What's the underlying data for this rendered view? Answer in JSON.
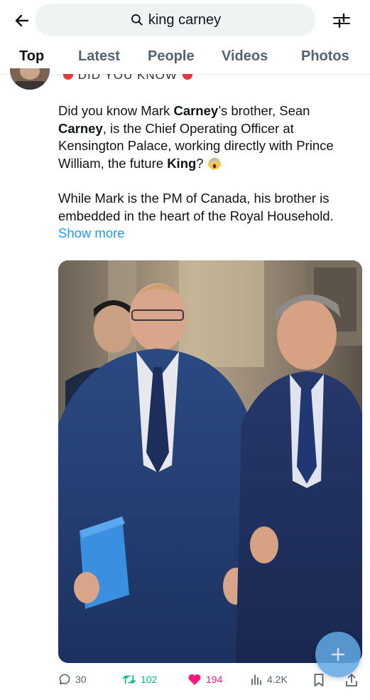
{
  "search": {
    "query": "king carney"
  },
  "tabs": [
    {
      "label": "Top",
      "active": true
    },
    {
      "label": "Latest",
      "active": false
    },
    {
      "label": "People",
      "active": false
    },
    {
      "label": "Videos",
      "active": false
    },
    {
      "label": "Photos",
      "active": false
    }
  ],
  "post": {
    "header_cut": "DID YOU KNOW",
    "para1_a": "Did you know Mark ",
    "para1_b": "Carney",
    "para1_c": "’s brother, Sean ",
    "para1_d": "Carney",
    "para1_e": ", is the Chief Operating Officer at Kensington Palace, working directly with Prince William, the future ",
    "para1_f": "King",
    "para1_g": "? ",
    "para2": "While Mark is the PM of Canada, his brother is embedded in the heart of the Royal Household. ",
    "show_more": "Show more"
  },
  "actions": {
    "replies": "30",
    "reposts": "102",
    "likes": "194",
    "views": "4.2K"
  },
  "colors": {
    "accent": "#1d9bf0",
    "repost": "#00ba7c",
    "like": "#f91880",
    "muted": "#536471"
  }
}
